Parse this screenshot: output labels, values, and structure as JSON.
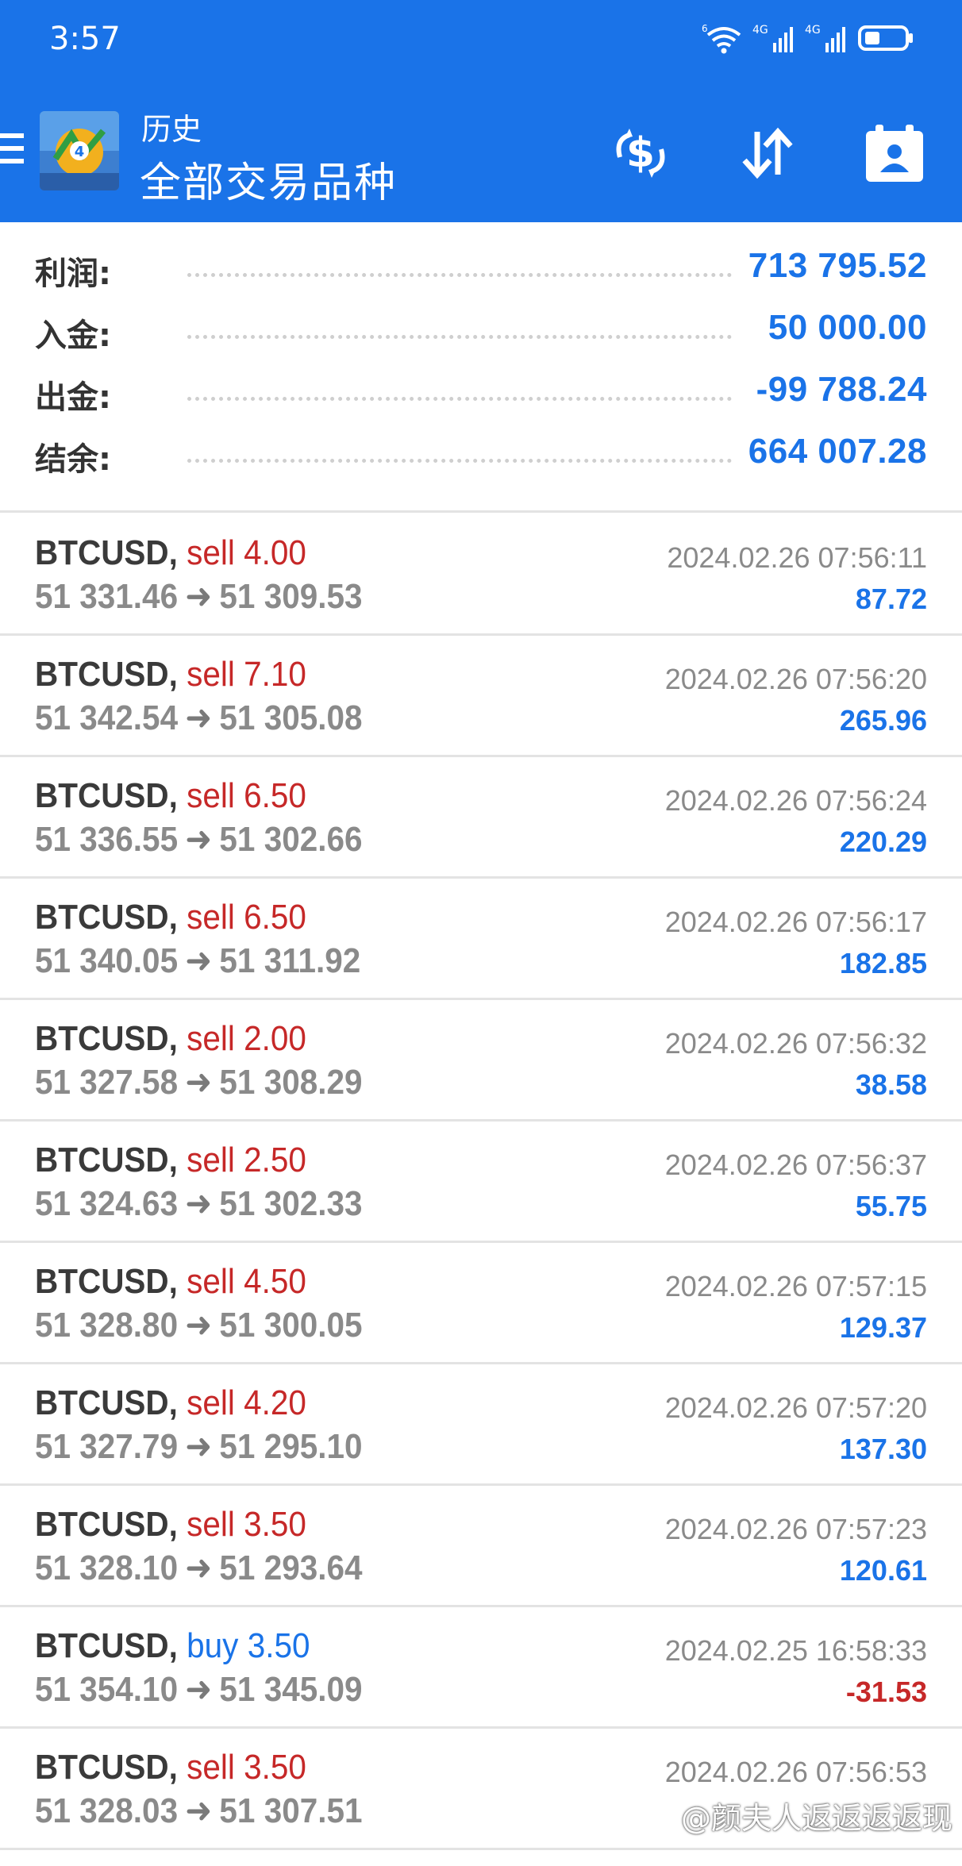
{
  "status_bar": {
    "time": "3:57",
    "wifi_badge": "6",
    "sim1": "4G",
    "sim2": "4G"
  },
  "header": {
    "title": "历史",
    "subtitle": "全部交易品种",
    "icons": [
      "menu-icon",
      "app-logo",
      "balance-icon",
      "sort-icon",
      "calendar-icon"
    ]
  },
  "summary": [
    {
      "label": "利润:",
      "value": "713 795.52"
    },
    {
      "label": "入金:",
      "value": "50 000.00"
    },
    {
      "label": "出金:",
      "value": "-99 788.24"
    },
    {
      "label": "结余:",
      "value": "664 007.28"
    }
  ],
  "trades": [
    {
      "symbol": "BTCUSD",
      "side": "sell",
      "volume": "4.00",
      "open": "51 331.46",
      "close": "51 309.53",
      "time": "2024.02.26 07:56:11",
      "profit": "87.72"
    },
    {
      "symbol": "BTCUSD",
      "side": "sell",
      "volume": "7.10",
      "open": "51 342.54",
      "close": "51 305.08",
      "time": "2024.02.26 07:56:20",
      "profit": "265.96"
    },
    {
      "symbol": "BTCUSD",
      "side": "sell",
      "volume": "6.50",
      "open": "51 336.55",
      "close": "51 302.66",
      "time": "2024.02.26 07:56:24",
      "profit": "220.29"
    },
    {
      "symbol": "BTCUSD",
      "side": "sell",
      "volume": "6.50",
      "open": "51 340.05",
      "close": "51 311.92",
      "time": "2024.02.26 07:56:17",
      "profit": "182.85"
    },
    {
      "symbol": "BTCUSD",
      "side": "sell",
      "volume": "2.00",
      "open": "51 327.58",
      "close": "51 308.29",
      "time": "2024.02.26 07:56:32",
      "profit": "38.58"
    },
    {
      "symbol": "BTCUSD",
      "side": "sell",
      "volume": "2.50",
      "open": "51 324.63",
      "close": "51 302.33",
      "time": "2024.02.26 07:56:37",
      "profit": "55.75"
    },
    {
      "symbol": "BTCUSD",
      "side": "sell",
      "volume": "4.50",
      "open": "51 328.80",
      "close": "51 300.05",
      "time": "2024.02.26 07:57:15",
      "profit": "129.37"
    },
    {
      "symbol": "BTCUSD",
      "side": "sell",
      "volume": "4.20",
      "open": "51 327.79",
      "close": "51 295.10",
      "time": "2024.02.26 07:57:20",
      "profit": "137.30"
    },
    {
      "symbol": "BTCUSD",
      "side": "sell",
      "volume": "3.50",
      "open": "51 328.10",
      "close": "51 293.64",
      "time": "2024.02.26 07:57:23",
      "profit": "120.61"
    },
    {
      "symbol": "BTCUSD",
      "side": "buy",
      "volume": "3.50",
      "open": "51 354.10",
      "close": "51 345.09",
      "time": "2024.02.25 16:58:33",
      "profit": "-31.53"
    },
    {
      "symbol": "BTCUSD",
      "side": "sell",
      "volume": "3.50",
      "open": "51 328.03",
      "close": "51 307.51",
      "time": "2024.02.26 07:56:53",
      "profit": ""
    }
  ],
  "watermark": "@颜夫人返返返返现",
  "colors": {
    "accent": "#1a73e8",
    "sell": "#c62828",
    "buy": "#1a73e8",
    "loss": "#c62828",
    "muted": "#8a8a8a"
  }
}
